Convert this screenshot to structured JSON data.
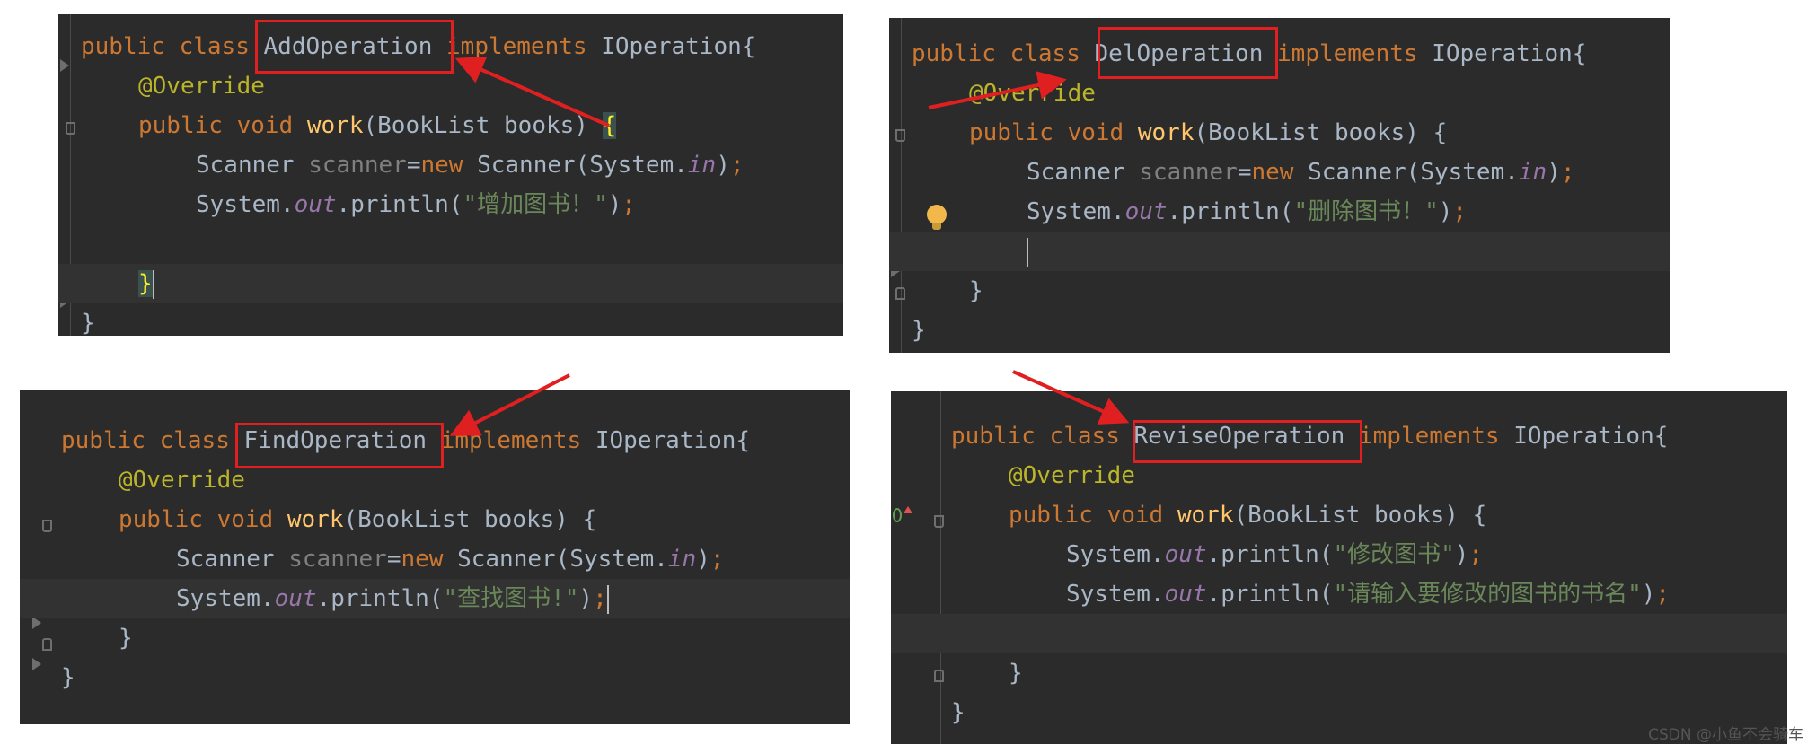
{
  "panels": {
    "add": {
      "kw_public": "public",
      "kw_class": "class",
      "class_name": "AddOperation",
      "kw_implements": "implements",
      "interface": "IOperation{",
      "annotation": "@Override",
      "kw_void": "void",
      "method": "work",
      "params": "(BookList books) ",
      "open_brace": "{",
      "scanner_type": "Scanner ",
      "scanner_var": "scanner",
      "eq": "=",
      "kw_new": "new",
      "scanner_ctor": " Scanner(System.",
      "field_in": "in",
      "close_paren": ")",
      "semi": ";",
      "system": "System.",
      "field_out": "out",
      "println": ".println(",
      "message": "\"增加图书！\"",
      "close_brace": "}",
      "class_close": "}"
    },
    "del": {
      "kw_public": "public",
      "kw_class": "class",
      "class_name": "DelOperation",
      "kw_implements": "implements",
      "interface": "IOperation{",
      "annotation": "@Override",
      "kw_void": "void",
      "method": "work",
      "params": "(BookList books) {",
      "scanner_type": "Scanner ",
      "scanner_var": "scanner",
      "eq": "=",
      "kw_new": "new",
      "scanner_ctor": " Scanner(System.",
      "field_in": "in",
      "close_paren": ")",
      "semi": ";",
      "system": "System.",
      "field_out": "out",
      "println": ".println(",
      "message": "\"删除图书！\"",
      "close_brace": "}",
      "class_close": "}"
    },
    "find": {
      "kw_public": "public",
      "kw_class": "class",
      "class_name": "FindOperation",
      "kw_implements": "implements",
      "interface": "IOperation{",
      "annotation": "@Override",
      "kw_void": "void",
      "method": "work",
      "params": "(BookList books) {",
      "scanner_type": "Scanner ",
      "scanner_var": "scanner",
      "eq": "=",
      "kw_new": "new",
      "scanner_ctor": " Scanner(System.",
      "field_in": "in",
      "close_paren": ")",
      "semi": ";",
      "system": "System.",
      "field_out": "out",
      "println": ".println(",
      "message": "\"查找图书!\"",
      "close_brace": "}",
      "class_close": "}"
    },
    "revise": {
      "kw_public": "public",
      "kw_class": "class",
      "class_name": "ReviseOperation",
      "kw_implements": "implements",
      "interface": "IOperation{",
      "annotation": "@Override",
      "kw_void": "void",
      "method": "work",
      "params": "(BookList books) {",
      "system": "System.",
      "field_out": "out",
      "println": ".println(",
      "message1": "\"修改图书\"",
      "message2": "\"请输入要修改的图书的书名\"",
      "close_paren": ")",
      "semi": ";",
      "close_brace": "}",
      "class_close": "}"
    }
  },
  "colors": {
    "editor_bg": "#2b2b2b",
    "keyword": "#cc7832",
    "annotation": "#bbb529",
    "method": "#ffc66d",
    "field": "#9876aa",
    "string": "#6a8759",
    "plain": "#a9b7c6",
    "highlight_box": "#e02020"
  },
  "watermark": "CSDN @小鱼不会骑车"
}
